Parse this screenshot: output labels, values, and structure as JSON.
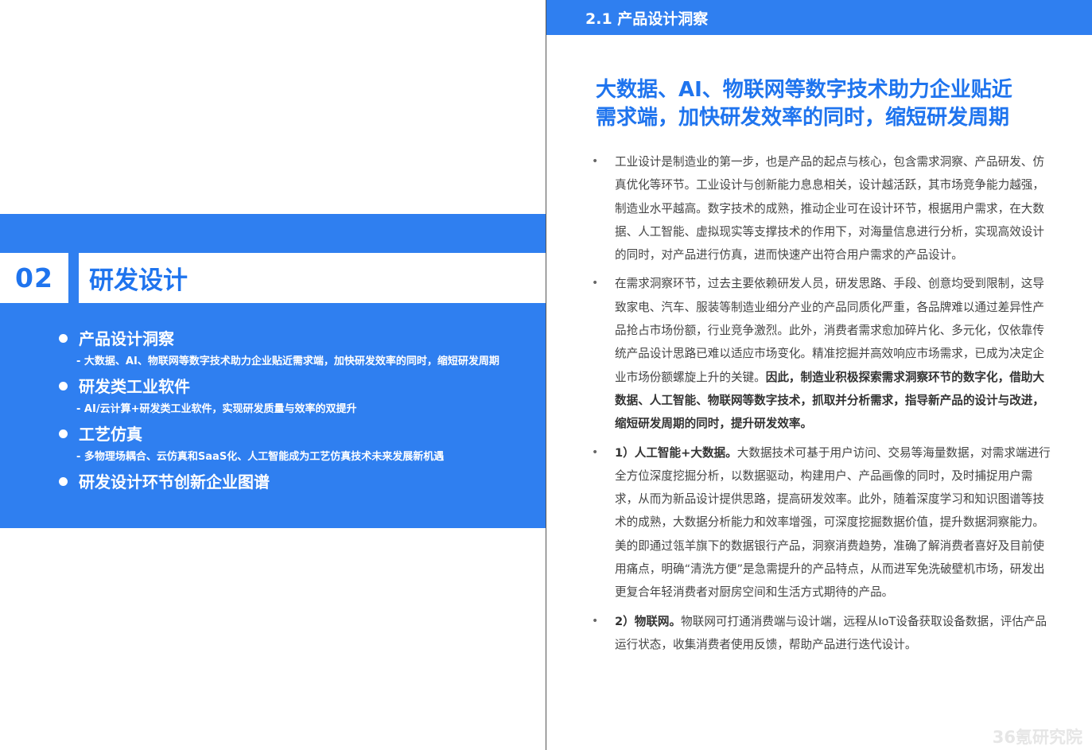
{
  "left": {
    "chapter_number": "02",
    "chapter_title": "研发设计",
    "toc": [
      {
        "title": "产品设计洞察",
        "subtitle": "- 大数据、AI、物联网等数字技术助力企业贴近需求端，加快研发效率的同时，缩短研发周期"
      },
      {
        "title": "研发类工业软件",
        "subtitle": "- AI/云计算+研发类工业软件，实现研发质量与效率的双提升"
      },
      {
        "title": "工艺仿真",
        "subtitle": "- 多物理场耦合、云仿真和SaaS化、人工智能成为工艺仿真技术未来发展新机遇"
      },
      {
        "title": "研发设计环节创新企业图谱",
        "subtitle": ""
      }
    ]
  },
  "right": {
    "section_header": "2.1 产品设计洞察",
    "headline_line1": "大数据、AI、物联网等数字技术助力企业贴近",
    "headline_line2": "需求端，加快研发效率的同时，缩短研发周期",
    "bullet_char": "•",
    "paragraphs": [
      {
        "lead": "",
        "text": "工业设计是制造业的第一步，也是产品的起点与核心，包含需求洞察、产品研发、仿真优化等环节。工业设计与创新能力息息相关，设计越活跃，其市场竞争能力越强，制造业水平越高。数字技术的成熟，推动企业可在设计环节，根据用户需求，在大数据、人工智能、虚拟现实等支撑技术的作用下，对海量信息进行分析，实现高效设计的同时，对产品进行仿真，进而快速产出符合用户需求的产品设计。",
        "tail": ""
      },
      {
        "lead": "",
        "text": "在需求洞察环节，过去主要依赖研发人员，研发思路、手段、创意均受到限制，这导致家电、汽车、服装等制造业细分产业的产品同质化严重，各品牌难以通过差异性产品抢占市场份额，行业竞争激烈。此外，消费者需求愈加碎片化、多元化，仅依靠传统产品设计思路已难以适应市场变化。精准挖掘并高效响应市场需求，已成为决定企业市场份额螺旋上升的关键。",
        "tail": "因此，制造业积极探索需求洞察环节的数字化，借助大数据、人工智能、物联网等数字技术，抓取并分析需求，指导新产品的设计与改进，缩短研发周期的同时，提升研发效率。"
      },
      {
        "lead": "1）人工智能+大数据。",
        "text": "大数据技术可基于用户访问、交易等海量数据，对需求端进行全方位深度挖掘分析，以数据驱动，构建用户、产品画像的同时，及时捕捉用户需求，从而为新品设计提供思路，提高研发效率。此外，随着深度学习和知识图谱等技术的成熟，大数据分析能力和效率增强，可深度挖掘数据价值，提升数据洞察能力。美的即通过瓴羊旗下的数据银行产品，洞察消费趋势，准确了解消费者喜好及目前使用痛点，明确“清洗方便”是急需提升的产品特点，从而进军免洗破壁机市场，研发出更复合年轻消费者对厨房空间和生活方式期待的产品。",
        "tail": ""
      },
      {
        "lead": "2）物联网。",
        "text": "物联网可打通消费端与设计端，远程从IoT设备获取设备数据，评估产品运行状态，收集消费者使用反馈，帮助产品进行迭代设计。",
        "tail": ""
      }
    ],
    "watermark": "36氪研究院"
  }
}
